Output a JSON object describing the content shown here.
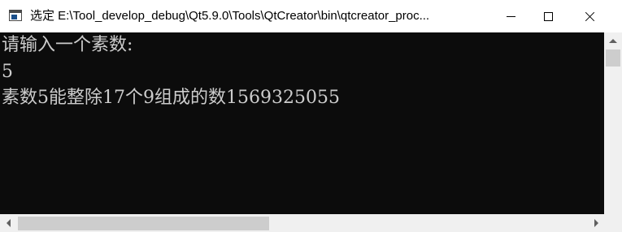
{
  "window": {
    "title": "选定 E:\\Tool_develop_debug\\Qt5.9.0\\Tools\\QtCreator\\bin\\qtcreator_proc...",
    "app_icon": "console-app-icon",
    "controls": {
      "minimize": "minimize-icon",
      "maximize": "maximize-icon",
      "close": "close-icon"
    }
  },
  "console": {
    "background": "#0c0c0c",
    "foreground": "#cccccc",
    "lines": [
      "请输入一个素数:",
      "5",
      "素数5能整除17个9组成的数1569325055"
    ]
  },
  "scrollbars": {
    "vertical": {
      "up_icon": "arrow-up-icon"
    },
    "horizontal": {
      "left_icon": "arrow-left-icon",
      "right_icon": "arrow-right-icon"
    }
  }
}
